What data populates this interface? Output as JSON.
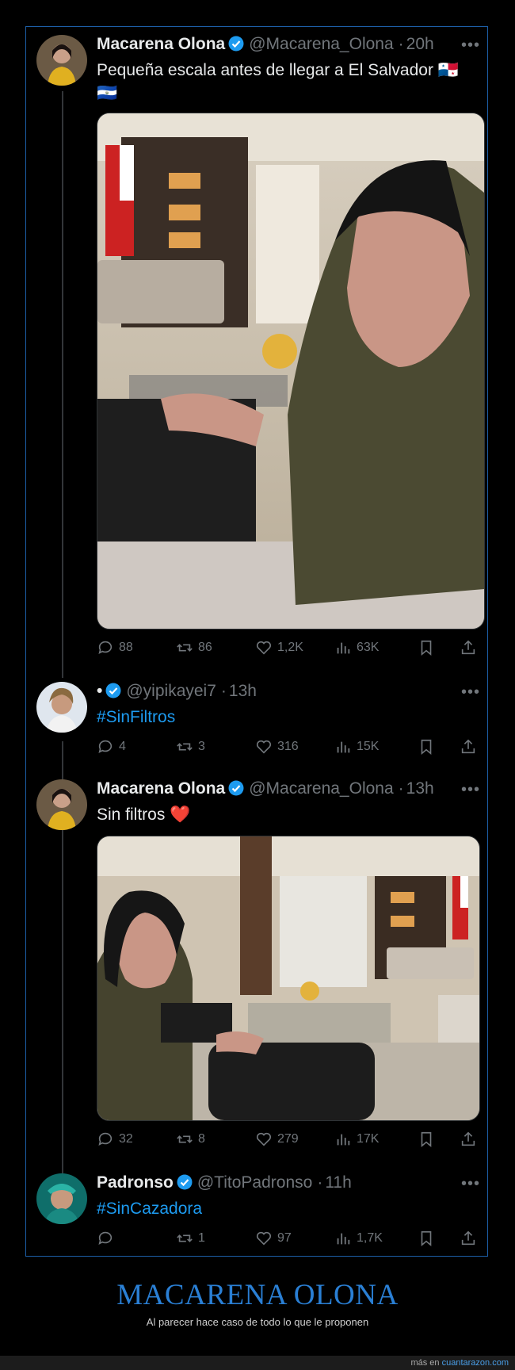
{
  "tweets": [
    {
      "name": "Macarena Olona",
      "handle": "@Macarena_Olona",
      "time": "20h",
      "text": "Pequeña escala antes de llegar a El Salvador 🇵🇦 🇸🇻",
      "stats": {
        "replies": "88",
        "retweets": "86",
        "likes": "1,2K",
        "views": "63K"
      }
    },
    {
      "name": "•",
      "handle": "@yipikayei7",
      "time": "13h",
      "text": "#SinFiltros",
      "stats": {
        "replies": "4",
        "retweets": "3",
        "likes": "316",
        "views": "15K"
      }
    },
    {
      "name": "Macarena Olona",
      "handle": "@Macarena_Olona",
      "time": "13h",
      "text": "Sin filtros ❤️",
      "stats": {
        "replies": "32",
        "retweets": "8",
        "likes": "279",
        "views": "17K"
      }
    },
    {
      "name": "Padronso",
      "handle": "@TitoPadronso",
      "time": "11h",
      "text": "#SinCazadora",
      "stats": {
        "replies": "",
        "retweets": "1",
        "likes": "97",
        "views": "1,7K"
      }
    }
  ],
  "caption": {
    "title": "MACARENA OLONA",
    "subtitle": "Al parecer hace caso de todo lo que le proponen"
  },
  "footer": {
    "prefix": "más en",
    "link": "cuantarazon.com"
  },
  "colors": {
    "accent": "#1d9bf0",
    "frame": "#1d5fa8",
    "caption": "#2a7fd4"
  }
}
